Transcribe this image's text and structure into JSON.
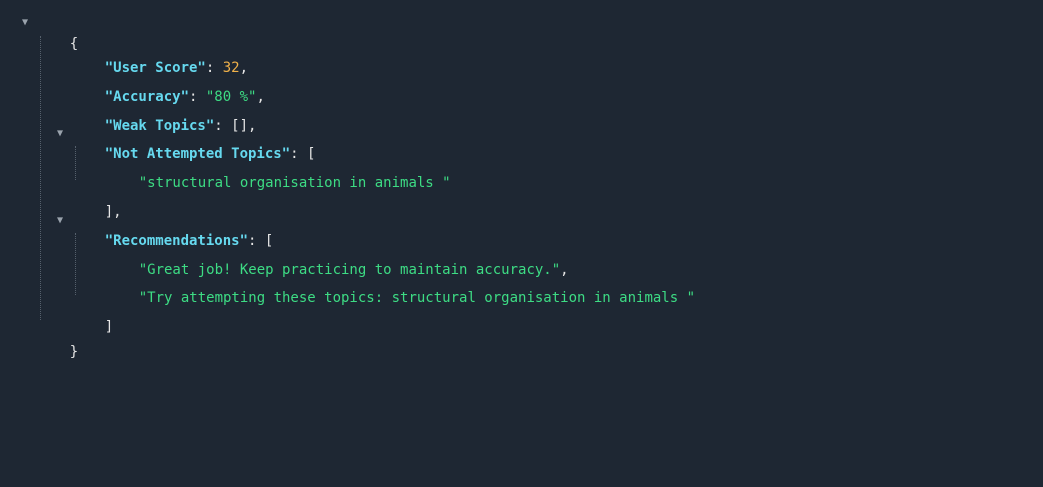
{
  "json": {
    "open_brace": "{",
    "close_brace": "}",
    "user_score": {
      "key": "\"User Score\"",
      "value": "32"
    },
    "accuracy": {
      "key": "\"Accuracy\"",
      "value": "\"80 %\""
    },
    "weak_topics": {
      "key": "\"Weak Topics\"",
      "value": "[]"
    },
    "not_attempted": {
      "key": "\"Not Attempted Topics\"",
      "items": [
        "\"structural organisation in animals \""
      ]
    },
    "recommendations": {
      "key": "\"Recommendations\"",
      "items": [
        "\"Great job! Keep practicing to maintain accuracy.\"",
        "\"Try attempting these topics: structural organisation in animals \""
      ]
    }
  },
  "colors": {
    "background": "#1e2733",
    "key": "#66d9ef",
    "string": "#3ddc84",
    "number": "#f0b14a",
    "punctuation": "#e6e6e6"
  },
  "icons": {
    "collapse": "triangle-down-icon"
  }
}
